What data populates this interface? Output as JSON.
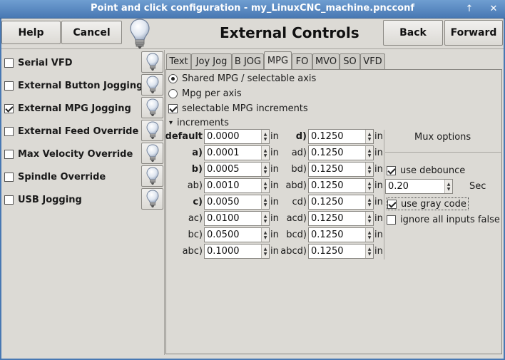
{
  "window": {
    "title": "Point and click configuration - my_LinuxCNC_machine.pncconf",
    "up_glyph": "↑",
    "close_glyph": "✕"
  },
  "toolbar": {
    "help_label": "Help",
    "cancel_label": "Cancel",
    "back_label": "Back",
    "forward_label": "Forward",
    "heading": "External Controls"
  },
  "sidebar": {
    "items": [
      {
        "label": "Serial VFD",
        "checked": false
      },
      {
        "label": "External Button Jogging",
        "checked": false
      },
      {
        "label": "External MPG Jogging",
        "checked": true
      },
      {
        "label": "External Feed Override",
        "checked": false
      },
      {
        "label": "Max Velocity Override",
        "checked": false
      },
      {
        "label": "Spindle Override",
        "checked": false
      },
      {
        "label": "USB Jogging",
        "checked": false
      }
    ]
  },
  "tabs": [
    {
      "label": "Text",
      "active": false
    },
    {
      "label": "Joy Jog",
      "active": false
    },
    {
      "label": "B JOG",
      "active": false
    },
    {
      "label": "MPG",
      "active": true
    },
    {
      "label": "FO",
      "active": false
    },
    {
      "label": "MVO",
      "active": false
    },
    {
      "label": "SO",
      "active": false
    },
    {
      "label": "VFD",
      "active": false
    }
  ],
  "mpg": {
    "shared_label": "Shared MPG / selectable axis",
    "shared_selected": true,
    "per_axis_label": "Mpg per axis",
    "per_axis_selected": false,
    "selectable_label": "selectable MPG increments",
    "selectable_checked": true,
    "increments_label": "increments",
    "expander_glyph": "▾",
    "unit": "in",
    "left_column": [
      {
        "label": "default",
        "bold": true,
        "value": "0.0000"
      },
      {
        "label": "a)",
        "bold": true,
        "value": "0.0001"
      },
      {
        "label": "b)",
        "bold": true,
        "value": "0.0005"
      },
      {
        "label": "ab)",
        "bold": false,
        "value": "0.0010"
      },
      {
        "label": "c)",
        "bold": true,
        "value": "0.0050"
      },
      {
        "label": "ac)",
        "bold": false,
        "value": "0.0100"
      },
      {
        "label": "bc)",
        "bold": false,
        "value": "0.0500"
      },
      {
        "label": "abc)",
        "bold": false,
        "value": "0.1000"
      }
    ],
    "right_column": [
      {
        "label": "d)",
        "bold": true,
        "value": "0.1250"
      },
      {
        "label": "ad)",
        "bold": false,
        "value": "0.1250"
      },
      {
        "label": "bd)",
        "bold": false,
        "value": "0.1250"
      },
      {
        "label": "abd)",
        "bold": false,
        "value": "0.1250"
      },
      {
        "label": "cd)",
        "bold": false,
        "value": "0.1250"
      },
      {
        "label": "acd)",
        "bold": false,
        "value": "0.1250"
      },
      {
        "label": "bcd)",
        "bold": false,
        "value": "0.1250"
      },
      {
        "label": "abcd)",
        "bold": false,
        "value": "0.1250"
      }
    ],
    "mux_label": "Mux options",
    "debounce_label": "use debounce",
    "debounce_checked": true,
    "debounce_value": "0.20",
    "sec_label": "Sec",
    "gray_code_label": "use gray code",
    "gray_code_checked": true,
    "ignore_false_label": "ignore all inputs false",
    "ignore_false_checked": false
  }
}
